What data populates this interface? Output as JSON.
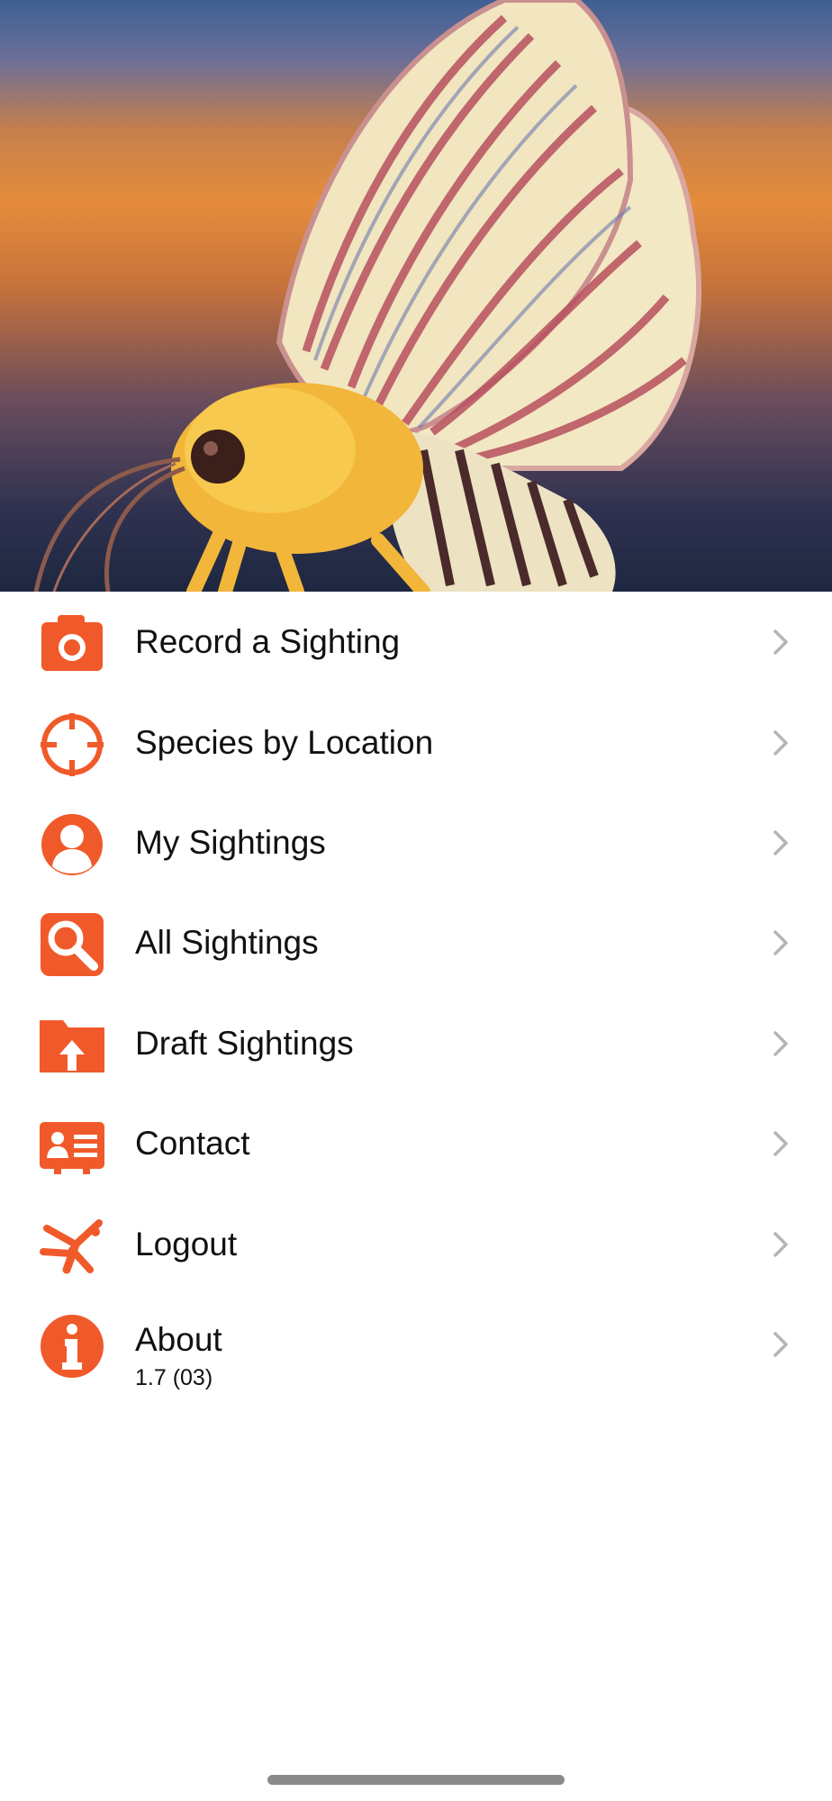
{
  "hero": {
    "image": "butterfly-photo"
  },
  "menu": {
    "items": [
      {
        "label": "Record a Sighting",
        "icon": "camera-icon"
      },
      {
        "label": "Species by Location",
        "icon": "crosshair-icon"
      },
      {
        "label": "My Sightings",
        "icon": "user-icon"
      },
      {
        "label": "All Sightings",
        "icon": "search-icon"
      },
      {
        "label": "Draft Sightings",
        "icon": "folder-upload-icon"
      },
      {
        "label": "Contact",
        "icon": "contact-card-icon"
      },
      {
        "label": "Logout",
        "icon": "logout-figure-icon"
      },
      {
        "label": "About",
        "sub": "1.7 (03)",
        "icon": "info-icon"
      }
    ]
  },
  "colors": {
    "accent": "#f05a2a",
    "chevron": "#b5b5b5",
    "text": "#111111"
  }
}
